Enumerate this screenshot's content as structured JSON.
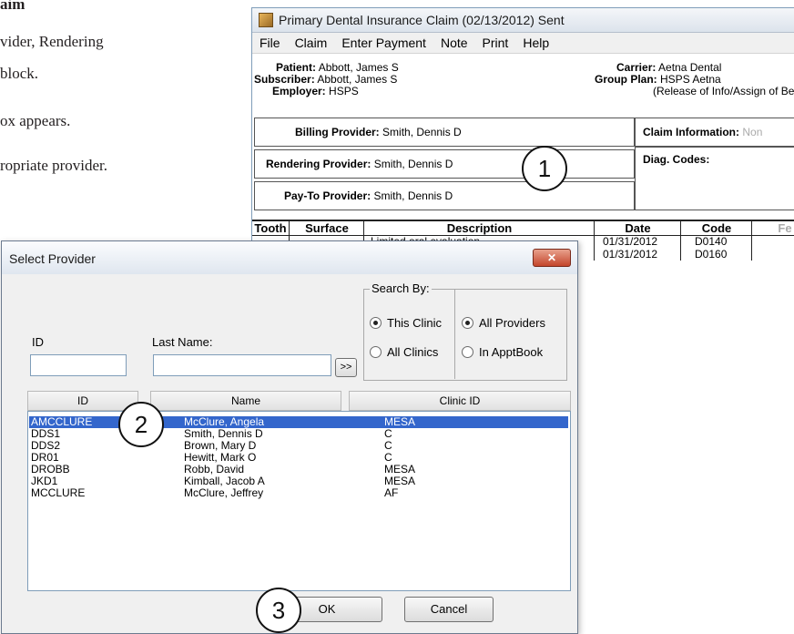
{
  "doc": {
    "title": "aim",
    "line1": "vider, Rendering",
    "line2": "block.",
    "line3": "ox appears.",
    "line4": "ropriate provider."
  },
  "claim": {
    "title": "Primary Dental Insurance Claim (02/13/2012) Sent",
    "menu": [
      "File",
      "Claim",
      "Enter Payment",
      "Note",
      "Print",
      "Help"
    ],
    "patient_label": "Patient:",
    "patient": "Abbott, James S",
    "subscriber_label": "Subscriber:",
    "subscriber": "Abbott, James S",
    "employer_label": "Employer:",
    "employer": "HSPS",
    "carrier_label": "Carrier:",
    "carrier": "Aetna Dental",
    "groupplan_label": "Group Plan:",
    "groupplan": "HSPS Aetna",
    "release": "(Release of Info/Assign of Be",
    "billing_label": "Billing Provider:",
    "billing": "Smith, Dennis D",
    "rendering_label": "Rendering Provider:",
    "rendering": "Smith, Dennis D",
    "payto_label": "Pay-To Provider:",
    "payto": "Smith, Dennis D",
    "claiminfo_label": "Claim Information:",
    "claiminfo": "Non",
    "diag_label": "Diag. Codes:",
    "grid_headers": [
      "Tooth",
      "Surface",
      "Description",
      "Date",
      "Code",
      "Fe"
    ],
    "rows": [
      {
        "description": "Limited oral evaluation",
        "date": "01/31/2012",
        "code": "D0140"
      },
      {
        "description": "",
        "date": "01/31/2012",
        "code": "D0160"
      }
    ]
  },
  "dialog": {
    "title": "Select Provider",
    "close": "✕",
    "search_by": "Search By:",
    "this_clinic": "This Clinic",
    "all_clinics": "All Clinics",
    "all_providers": "All Providers",
    "in_apptbook": "In ApptBook",
    "id_label": "ID",
    "last_name_label": "Last Name:",
    "id_value": "",
    "last_name_value": "",
    "go": ">>",
    "col_id": "ID",
    "col_name": "Name",
    "col_clinic": "Clinic ID",
    "providers": [
      {
        "id": "AMCCLURE",
        "name": "McClure, Angela",
        "clinic": "MESA"
      },
      {
        "id": "DDS1",
        "name": "Smith, Dennis D",
        "clinic": "C"
      },
      {
        "id": "DDS2",
        "name": "Brown, Mary D",
        "clinic": "C"
      },
      {
        "id": "DR01",
        "name": "Hewitt, Mark O",
        "clinic": "C"
      },
      {
        "id": "DROBB",
        "name": "Robb, David",
        "clinic": "MESA"
      },
      {
        "id": "JKD1",
        "name": "Kimball, Jacob A",
        "clinic": "MESA"
      },
      {
        "id": "MCCLURE",
        "name": "McClure, Jeffrey",
        "clinic": "AF"
      }
    ],
    "ok": "OK",
    "cancel": "Cancel"
  },
  "callouts": [
    "1",
    "2",
    "3"
  ]
}
